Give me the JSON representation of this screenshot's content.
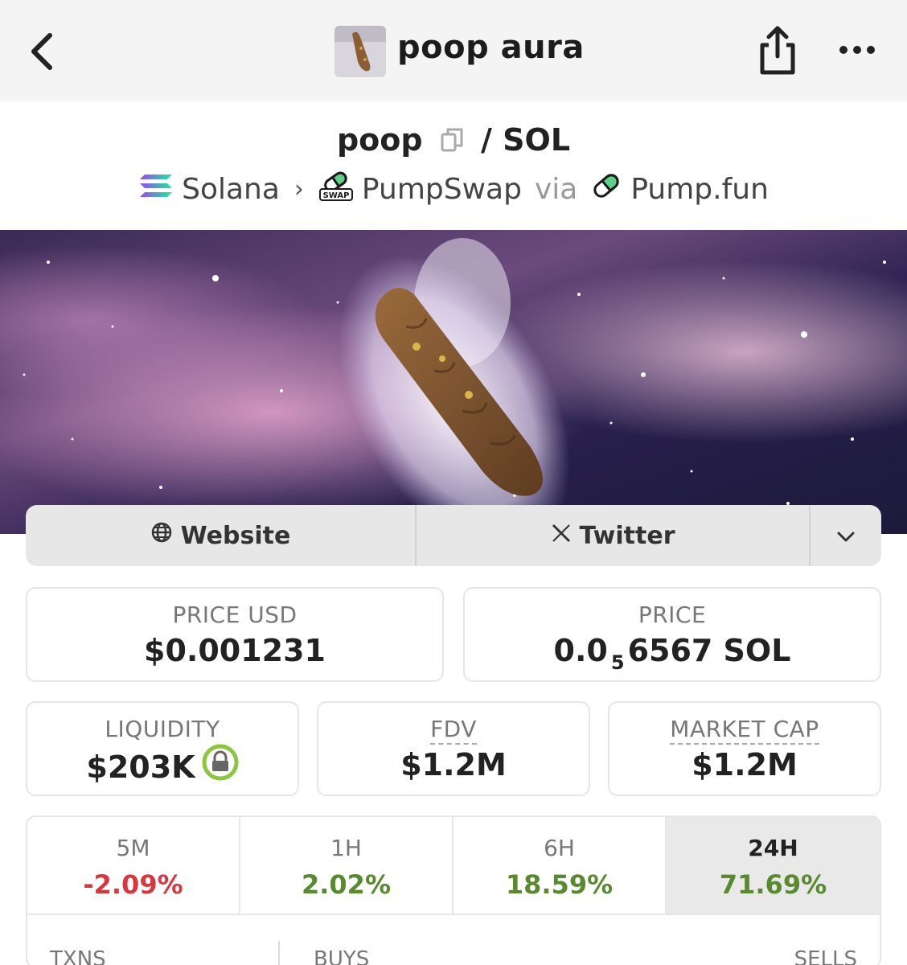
{
  "header": {
    "title": "poop aura",
    "icons": {
      "back": "chevron-left-icon",
      "share": "share-icon",
      "more": "more-icon"
    }
  },
  "pair": {
    "base": "poop",
    "separator": "/",
    "quote": "SOL",
    "copy_icon": "copy-icon"
  },
  "route": {
    "chain": "Solana",
    "dex": "PumpSwap",
    "via": "via",
    "launchpad": "Pump.fun",
    "dex_badge": "SWAP"
  },
  "links": {
    "website": "Website",
    "twitter": "Twitter"
  },
  "stats": {
    "price_usd_label": "PRICE USD",
    "price_usd": "$0.001231",
    "price_label": "PRICE",
    "price_prefix": "0.0",
    "price_subscript": "5",
    "price_suffix": "6567 SOL",
    "liquidity_label": "LIQUIDITY",
    "liquidity": "$203K",
    "fdv_label": "FDV",
    "fdv": "$1.2M",
    "mcap_label": "MARKET CAP",
    "mcap": "$1.2M"
  },
  "changes": [
    {
      "label": "5M",
      "value": "-2.09%"
    },
    {
      "label": "1H",
      "value": "2.02%"
    },
    {
      "label": "6H",
      "value": "18.59%"
    },
    {
      "label": "24H",
      "value": "71.69%"
    }
  ],
  "txns": {
    "txns_label": "TXNS",
    "buys_label": "BUYS",
    "sells_label": "SELLS"
  },
  "colors": {
    "negative": "#d9363e",
    "positive": "#5a8a2e",
    "lock": "#8cc63f"
  }
}
